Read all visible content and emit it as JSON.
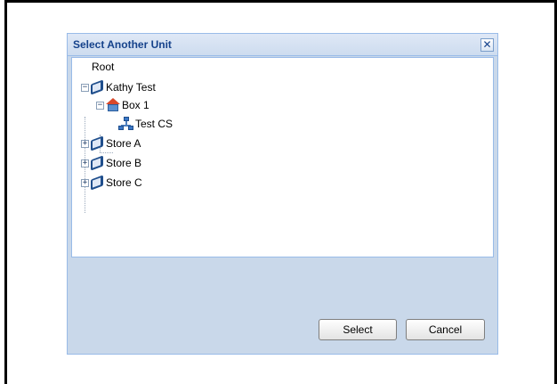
{
  "dialog": {
    "title": "Select Another Unit",
    "close_glyph": "✕",
    "close_icon": "close-icon"
  },
  "tree": {
    "root_label": "Root",
    "nodes": [
      {
        "label": "Kathy Test",
        "icon": "book-icon",
        "toggle": "⊟",
        "expanded": true
      },
      {
        "label": "Box 1",
        "icon": "house-icon",
        "toggle": "⊟",
        "expanded": true
      },
      {
        "label": "Test CS",
        "icon": "network-icon"
      },
      {
        "label": "Store A",
        "icon": "book-icon",
        "toggle": "⊞",
        "expanded": false
      },
      {
        "label": "Store B",
        "icon": "book-icon",
        "toggle": "⊞",
        "expanded": false
      },
      {
        "label": "Store C",
        "icon": "book-icon",
        "toggle": "⊞",
        "expanded": false
      }
    ]
  },
  "buttons": {
    "select_label": "Select",
    "cancel_label": "Cancel"
  }
}
